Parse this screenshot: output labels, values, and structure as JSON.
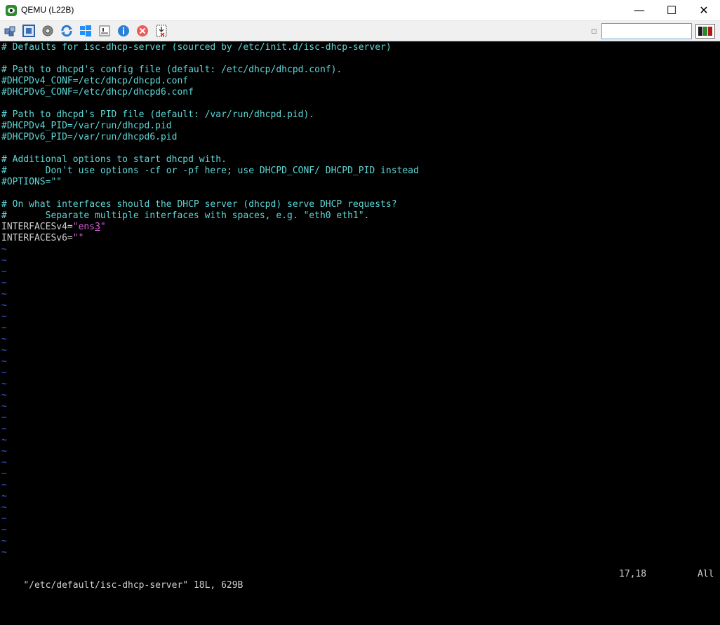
{
  "window": {
    "title": "QEMU (L22B)",
    "controls": {
      "minimize": "—",
      "maximize": "☐",
      "close": "✕"
    }
  },
  "toolbar": {
    "icons": [
      "network-icon",
      "fullscreen-icon",
      "settings-icon",
      "refresh-icon",
      "windows-icon",
      "console-icon",
      "info-icon",
      "stop-icon",
      "screenshot-icon"
    ],
    "search_value": ""
  },
  "editor": {
    "lines": [
      {
        "parts": [
          {
            "t": "# Defaults for isc-dhcp-server (sourced by /etc/init.d/isc-dhcp-server)",
            "c": "comment"
          }
        ]
      },
      {
        "parts": []
      },
      {
        "parts": [
          {
            "t": "# Path to dhcpd's config file (default: /etc/dhcp/dhcpd.conf).",
            "c": "comment"
          }
        ]
      },
      {
        "parts": [
          {
            "t": "#DHCPDv4_CONF=/etc/dhcp/dhcpd.conf",
            "c": "comment"
          }
        ]
      },
      {
        "parts": [
          {
            "t": "#DHCPDv6_CONF=/etc/dhcp/dhcpd6.conf",
            "c": "comment"
          }
        ]
      },
      {
        "parts": []
      },
      {
        "parts": [
          {
            "t": "# Path to dhcpd's PID file (default: /var/run/dhcpd.pid).",
            "c": "comment"
          }
        ]
      },
      {
        "parts": [
          {
            "t": "#DHCPDv4_PID=/var/run/dhcpd.pid",
            "c": "comment"
          }
        ]
      },
      {
        "parts": [
          {
            "t": "#DHCPDv6_PID=/var/run/dhcpd6.pid",
            "c": "comment"
          }
        ]
      },
      {
        "parts": []
      },
      {
        "parts": [
          {
            "t": "# Additional options to start dhcpd with.",
            "c": "comment"
          }
        ]
      },
      {
        "parts": [
          {
            "t": "#       Don't use options -cf or -pf here; use DHCPD_CONF/ DHCPD_PID instead",
            "c": "comment"
          }
        ]
      },
      {
        "parts": [
          {
            "t": "#OPTIONS=\"\"",
            "c": "comment"
          }
        ]
      },
      {
        "parts": []
      },
      {
        "parts": [
          {
            "t": "# On what interfaces should the DHCP server (dhcpd) serve DHCP requests?",
            "c": "comment"
          }
        ]
      },
      {
        "parts": [
          {
            "t": "#       Separate multiple interfaces with spaces, e.g. \"eth0 eth1\".",
            "c": "comment"
          }
        ]
      },
      {
        "parts": [
          {
            "t": "INTERFACESv4=",
            "c": "plain"
          },
          {
            "t": "\"ens",
            "c": "str"
          },
          {
            "t": "3",
            "c": "str cursor-ch"
          },
          {
            "t": "\"",
            "c": "str"
          }
        ]
      },
      {
        "parts": [
          {
            "t": "INTERFACESv6=",
            "c": "plain"
          },
          {
            "t": "\"\"",
            "c": "str"
          }
        ]
      }
    ],
    "tilde_char": "~",
    "tilde_count": 28,
    "status": {
      "file_info": "\"/etc/default/isc-dhcp-server\" 18L, 629B",
      "position": "17,18",
      "scroll": "All"
    }
  }
}
